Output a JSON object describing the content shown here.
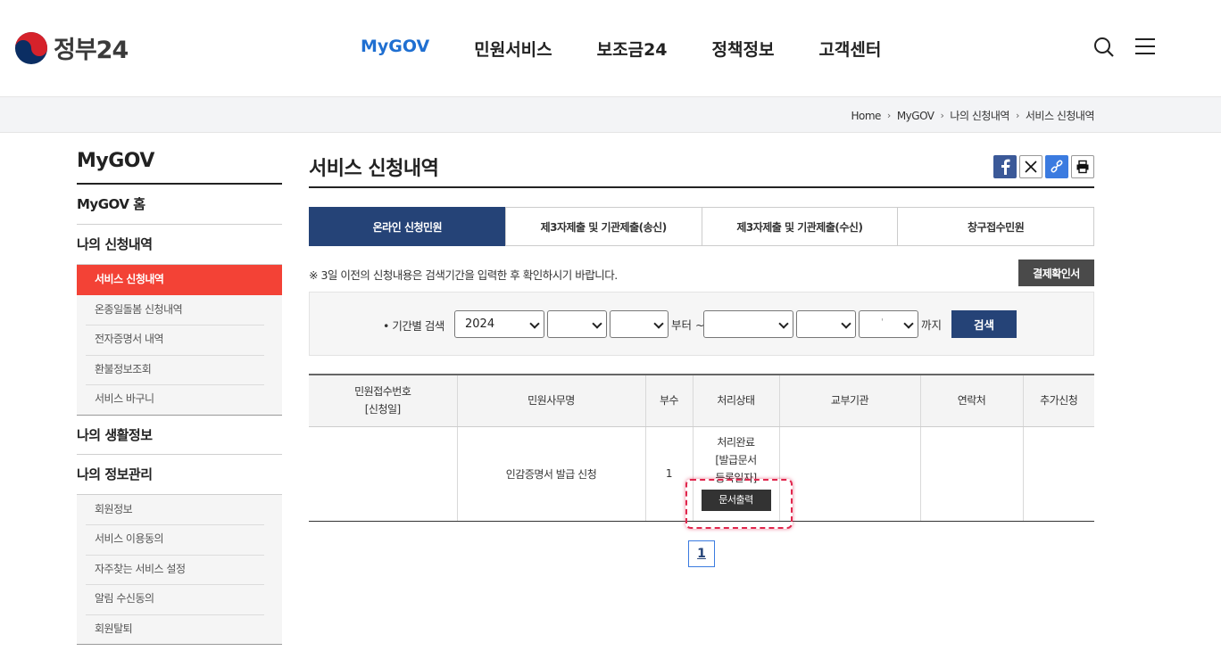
{
  "header": {
    "logo_text": "정부24",
    "nav": [
      "MyGOV",
      "민원서비스",
      "보조금24",
      "정책정보",
      "고객센터"
    ]
  },
  "breadcrumb": [
    "Home",
    "MyGOV",
    "나의 신청내역",
    "서비스 신청내역"
  ],
  "sidebar": {
    "title": "MyGOV",
    "home": "MyGOV 홈",
    "section1": "나의 신청내역",
    "section1_items": [
      "서비스 신청내역",
      "온종일돌봄 신청내역",
      "전자증명서 내역",
      "환불정보조회",
      "서비스 바구니"
    ],
    "section2": "나의 생활정보",
    "section3": "나의 정보관리",
    "section3_items": [
      "회원정보",
      "서비스 이용동의",
      "자주찾는 서비스 설정",
      "알림 수신동의",
      "회원탈퇴"
    ]
  },
  "main": {
    "title": "서비스 신청내역",
    "tabs": [
      "온라인 신청민원",
      "제3자제출 및 기관제출(송신)",
      "제3자제출 및 기관제출(수신)",
      "창구접수민원"
    ],
    "notice": "※ 3일 이전의 신청내용은 검색기간을 입력한 후 확인하시기 바랍니다.",
    "receipt_button": "결제확인서",
    "search": {
      "label": "• 기간별 검색",
      "year_from": "2024",
      "from_text": "부터 ~",
      "to_text": "까지",
      "dot": "'",
      "button": "검색"
    },
    "table": {
      "headers": [
        "민원접수번호\n[신청일]",
        "민원사무명",
        "부수",
        "처리상태",
        "교부기관",
        "연락처",
        "추가신청"
      ],
      "header_col1_line1": "민원접수번호",
      "header_col1_line2": "[신청일]",
      "row": {
        "service_name": "인감증명서 발급 신청",
        "copies": "1",
        "status_line1": "처리완료",
        "status_line2": "[발급문서",
        "status_line3": "등록일자]",
        "print_button": "문서출력"
      }
    },
    "pagination": [
      "1"
    ]
  },
  "colors": {
    "nav_active": "#1f6fd1",
    "tab_active": "#254377",
    "sidebar_active": "#f34236",
    "highlight": "#e0264d"
  }
}
